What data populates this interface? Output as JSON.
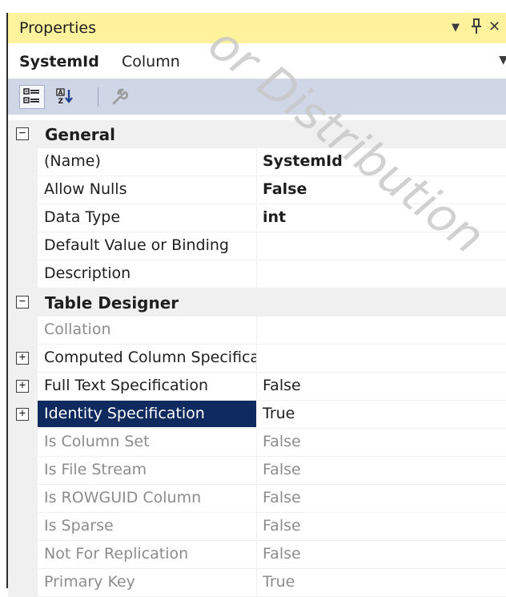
{
  "panel": {
    "title": "Properties",
    "title_icons": [
      "dropdown-arrow-icon",
      "pin-icon",
      "close-icon"
    ]
  },
  "object": {
    "name": "SystemId",
    "type": "Column"
  },
  "toolbar": {
    "buttons": [
      "categorized-icon",
      "alphabetical-icon",
      "property-pages-icon"
    ]
  },
  "watermark": "or Distribution",
  "categories": [
    {
      "label": "General",
      "expanded": true,
      "rows": [
        {
          "name": "(Name)",
          "value": "SystemId",
          "bold": true
        },
        {
          "name": "Allow Nulls",
          "value": "False",
          "bold": true
        },
        {
          "name": "Data Type",
          "value": "int",
          "bold": true
        },
        {
          "name": "Default Value or Binding",
          "value": ""
        },
        {
          "name": "Description",
          "value": ""
        }
      ]
    },
    {
      "label": "Table Designer",
      "expanded": true,
      "rows": [
        {
          "name": "Collation",
          "value": "",
          "dim": true
        },
        {
          "name": "Computed Column Specifica",
          "value": "",
          "expandable": true
        },
        {
          "name": "Full Text Specification",
          "value": "False",
          "expandable": true
        },
        {
          "name": "Identity Specification",
          "value": "True",
          "expandable": true,
          "selected": true
        },
        {
          "name": "Is Column Set",
          "value": "False",
          "dim": true
        },
        {
          "name": "Is File Stream",
          "value": "False",
          "dim": true
        },
        {
          "name": "Is ROWGUID Column",
          "value": "False",
          "dim": true
        },
        {
          "name": "Is Sparse",
          "value": "False",
          "dim": true
        },
        {
          "name": "Not For Replication",
          "value": "False",
          "dim": true
        },
        {
          "name": "Primary Key",
          "value": "True",
          "dim": true
        }
      ]
    }
  ],
  "colors": {
    "titlebar": "#fff29d",
    "toolbar": "#cfd6e5",
    "selection": "#0f2a5e",
    "category": "#f0f0f0"
  }
}
